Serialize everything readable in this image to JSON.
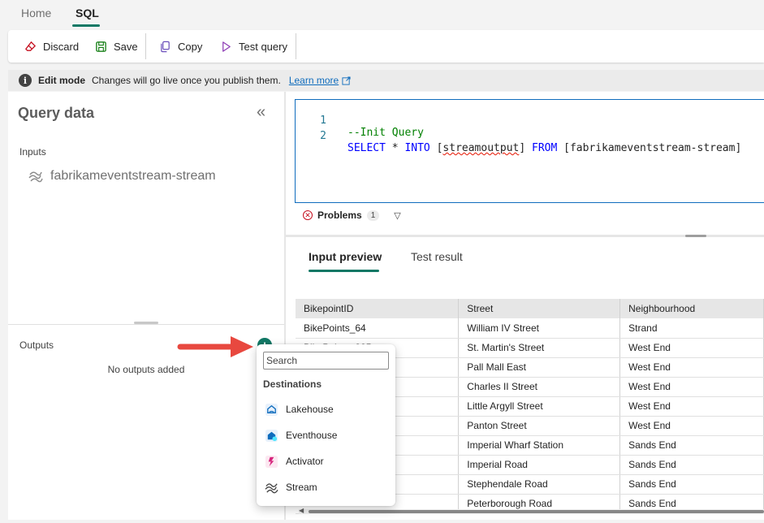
{
  "tabs": {
    "home": "Home",
    "sql": "SQL"
  },
  "toolbar": {
    "discard": "Discard",
    "save": "Save",
    "copy": "Copy",
    "test_query": "Test query"
  },
  "infobar": {
    "icon": "i",
    "title": "Edit mode",
    "message": "Changes will go live once you publish them.",
    "link": "Learn more"
  },
  "left_panel": {
    "title": "Query data",
    "inputs_label": "Inputs",
    "input_item": "fabrikameventstream-stream",
    "outputs_label": "Outputs",
    "no_outputs": "No outputs added",
    "add_icon": "+"
  },
  "editor": {
    "lines": [
      {
        "num": "1",
        "text": "--Init Query"
      },
      {
        "num": "2",
        "kw1": "SELECT",
        "mid1": " * ",
        "kw2": "INTO",
        "mid2": " [",
        "ident": "streamoutput",
        "mid3": "] ",
        "kw3": "FROM",
        "rest": " [fabrikameventstream-stream]"
      }
    ],
    "problems_label": "Problems",
    "problems_count": "1"
  },
  "preview": {
    "tabs": [
      "Input preview",
      "Test result"
    ],
    "columns": [
      "BikepointID",
      "Street",
      "Neighbourhood"
    ],
    "rows": [
      [
        "BikePoints_64",
        "William IV Street",
        "Strand"
      ],
      [
        "BikePoints_325",
        "St. Martin's Street",
        "West End"
      ],
      [
        "",
        "Pall Mall East",
        "West End"
      ],
      [
        "",
        "Charles II Street",
        "West End"
      ],
      [
        "",
        "Little Argyll Street",
        "West End"
      ],
      [
        "",
        "Panton Street",
        "West End"
      ],
      [
        "",
        "Imperial Wharf Station",
        "Sands End"
      ],
      [
        "",
        "Imperial Road",
        "Sands End"
      ],
      [
        "",
        "Stephendale Road",
        "Sands End"
      ],
      [
        "",
        "Peterborough Road",
        "Sands End"
      ]
    ]
  },
  "dropdown": {
    "search_placeholder": "Search",
    "header": "Destinations",
    "items": [
      "Lakehouse",
      "Eventhouse",
      "Activator",
      "Stream"
    ]
  },
  "colors": {
    "accent": "#117865",
    "link": "#0f6cbd",
    "annotation_arrow": "#e8483f"
  }
}
